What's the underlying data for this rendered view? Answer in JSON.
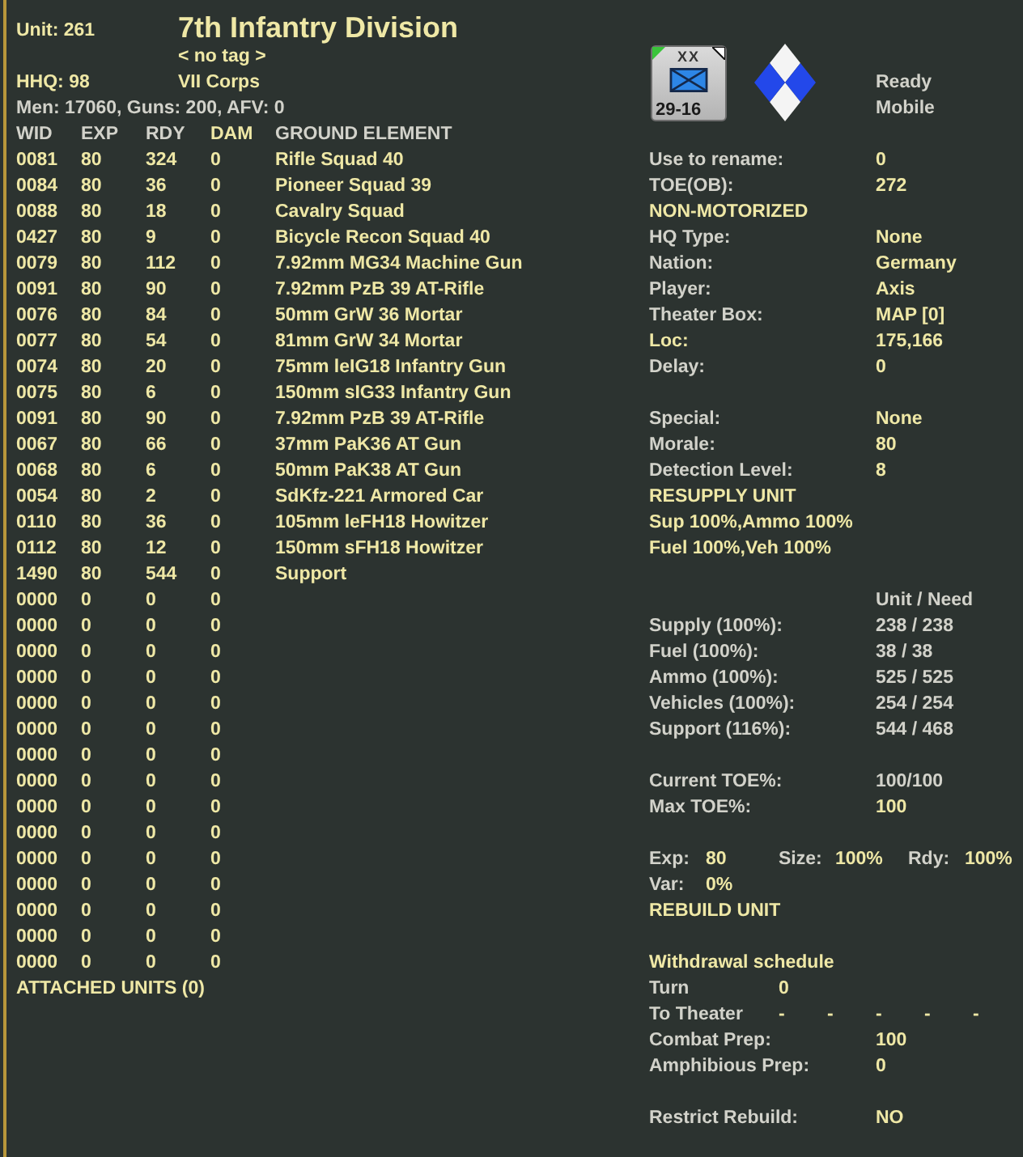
{
  "header": {
    "unit": "Unit: 261",
    "title": "7th Infantry Division",
    "tag": "< no tag >",
    "hhq": "HHQ: 98",
    "corps": "VII Corps",
    "summary": "Men: 17060, Guns: 200, AFV: 0"
  },
  "elements_table": {
    "columns": [
      {
        "label": "WID",
        "sorted": false
      },
      {
        "label": "EXP",
        "sorted": false
      },
      {
        "label": "RDY",
        "sorted": false
      },
      {
        "label": "DAM",
        "sorted": true
      },
      {
        "label": "GROUND ELEMENT",
        "sorted": false
      }
    ],
    "rows": [
      {
        "cells": [
          "0081",
          "80",
          "324",
          "0",
          "Rifle Squad 40"
        ]
      },
      {
        "cells": [
          "0084",
          "80",
          "36",
          "0",
          "Pioneer Squad 39"
        ]
      },
      {
        "cells": [
          "0088",
          "80",
          "18",
          "0",
          "Cavalry Squad"
        ]
      },
      {
        "cells": [
          "0427",
          "80",
          "9",
          "0",
          "Bicycle Recon Squad 40"
        ]
      },
      {
        "cells": [
          "0079",
          "80",
          "112",
          "0",
          "7.92mm MG34 Machine Gun"
        ]
      },
      {
        "cells": [
          "0091",
          "80",
          "90",
          "0",
          "7.92mm PzB 39 AT-Rifle"
        ]
      },
      {
        "cells": [
          "0076",
          "80",
          "84",
          "0",
          "50mm GrW 36 Mortar"
        ]
      },
      {
        "cells": [
          "0077",
          "80",
          "54",
          "0",
          "81mm GrW 34 Mortar"
        ]
      },
      {
        "cells": [
          "0074",
          "80",
          "20",
          "0",
          "75mm leIG18 Infantry Gun"
        ]
      },
      {
        "cells": [
          "0075",
          "80",
          "6",
          "0",
          "150mm sIG33 Infantry Gun"
        ]
      },
      {
        "cells": [
          "0091",
          "80",
          "90",
          "0",
          "7.92mm PzB 39 AT-Rifle"
        ]
      },
      {
        "cells": [
          "0067",
          "80",
          "66",
          "0",
          "37mm PaK36 AT Gun"
        ]
      },
      {
        "cells": [
          "0068",
          "80",
          "6",
          "0",
          "50mm PaK38 AT Gun"
        ]
      },
      {
        "cells": [
          "0054",
          "80",
          "2",
          "0",
          "SdKfz-221 Armored Car"
        ]
      },
      {
        "cells": [
          "0110",
          "80",
          "36",
          "0",
          "105mm leFH18 Howitzer"
        ]
      },
      {
        "cells": [
          "0112",
          "80",
          "12",
          "0",
          "150mm sFH18 Howitzer"
        ]
      },
      {
        "cells": [
          "1490",
          "80",
          "544",
          "0",
          "Support"
        ]
      },
      {
        "cells": [
          "0000",
          "0",
          "0",
          "0"
        ]
      },
      {
        "cells": [
          "0000",
          "0",
          "0",
          "0"
        ]
      },
      {
        "cells": [
          "0000",
          "0",
          "0",
          "0"
        ]
      },
      {
        "cells": [
          "0000",
          "0",
          "0",
          "0"
        ]
      },
      {
        "cells": [
          "0000",
          "0",
          "0",
          "0"
        ]
      },
      {
        "cells": [
          "0000",
          "0",
          "0",
          "0"
        ]
      },
      {
        "cells": [
          "0000",
          "0",
          "0",
          "0"
        ]
      },
      {
        "cells": [
          "0000",
          "0",
          "0",
          "0"
        ]
      },
      {
        "cells": [
          "0000",
          "0",
          "0",
          "0"
        ]
      },
      {
        "cells": [
          "0000",
          "0",
          "0",
          "0"
        ]
      },
      {
        "cells": [
          "0000",
          "0",
          "0",
          "0"
        ]
      },
      {
        "cells": [
          "0000",
          "0",
          "0",
          "0"
        ]
      },
      {
        "cells": [
          "0000",
          "0",
          "0",
          "0"
        ]
      },
      {
        "cells": [
          "0000",
          "0",
          "0",
          "0"
        ]
      },
      {
        "cells": [
          "0000",
          "0",
          "0",
          "0"
        ]
      }
    ]
  },
  "attached_units": "ATTACHED UNITS (0)",
  "counter": {
    "size": "XX",
    "values": "29-16"
  },
  "status": [
    "Ready",
    "Mobile"
  ],
  "sections": [
    {
      "rows": [
        {
          "kind": "field",
          "label": "Use to rename:",
          "value": "0"
        },
        {
          "kind": "field",
          "label": "TOE(OB):",
          "value": "272"
        },
        {
          "kind": "action",
          "text": "NON-MOTORIZED"
        },
        {
          "kind": "field",
          "label": "HQ Type:",
          "value": "None"
        },
        {
          "kind": "field",
          "label": "Nation:",
          "value": "Germany"
        },
        {
          "kind": "field",
          "label": "Player:",
          "value": "Axis"
        },
        {
          "kind": "field",
          "label": "Theater Box:",
          "value": "MAP [0]"
        },
        {
          "kind": "highlight",
          "label": "Loc:",
          "value": "175,166"
        },
        {
          "kind": "field",
          "label": "Delay:",
          "value": "0"
        }
      ]
    },
    {
      "rows": [
        {
          "kind": "field",
          "label": "Special:",
          "value": "None"
        },
        {
          "kind": "field",
          "label": "Morale:",
          "value": "80"
        },
        {
          "kind": "field",
          "label": "Detection Level:",
          "value": "8"
        },
        {
          "kind": "action",
          "text": "RESUPPLY UNIT"
        },
        {
          "kind": "note",
          "text": "Sup 100%,Ammo 100%"
        },
        {
          "kind": "note",
          "text": "Fuel 100%,Veh 100%"
        }
      ]
    },
    {
      "rows": [
        {
          "kind": "column_header",
          "text": "Unit / Need"
        },
        {
          "kind": "plain",
          "label": "Supply (100%):",
          "value": "238 / 238"
        },
        {
          "kind": "plain",
          "label": "Fuel (100%):",
          "value": "38 / 38"
        },
        {
          "kind": "plain",
          "label": "Ammo (100%):",
          "value": "525 / 525"
        },
        {
          "kind": "plain",
          "label": "Vehicles (100%):",
          "value": "254 / 254"
        },
        {
          "kind": "plain",
          "label": "Support (116%):",
          "value": "544 / 468"
        }
      ]
    },
    {
      "rows": [
        {
          "kind": "plain",
          "label": "Current TOE%:",
          "value": "100/100"
        },
        {
          "kind": "field",
          "label": "Max TOE%:",
          "value": "100"
        }
      ]
    },
    {
      "rows": [
        {
          "kind": "stats",
          "items": [
            {
              "label": "Exp:",
              "value": "80"
            },
            {
              "label": "Size:",
              "value": "100%"
            },
            {
              "label": "Rdy:",
              "value": "100%"
            }
          ]
        },
        {
          "kind": "stats",
          "items": [
            {
              "label": "Var:",
              "value": "0%"
            }
          ]
        },
        {
          "kind": "action",
          "text": "REBUILD UNIT"
        }
      ]
    },
    {
      "rows": [
        {
          "kind": "heading",
          "text": "Withdrawal schedule"
        },
        {
          "kind": "schedule",
          "label": "Turn",
          "cells": [
            "0"
          ]
        },
        {
          "kind": "schedule",
          "label": "To Theater",
          "cells": [
            "-",
            "-",
            "-",
            "-",
            "-"
          ]
        },
        {
          "kind": "field",
          "label": "Combat Prep:",
          "value": "100"
        },
        {
          "kind": "field",
          "label": "Amphibious Prep:",
          "value": "0"
        }
      ]
    },
    {
      "rows": [
        {
          "kind": "field",
          "label": "Restrict Rebuild:",
          "value": "NO"
        }
      ]
    }
  ]
}
